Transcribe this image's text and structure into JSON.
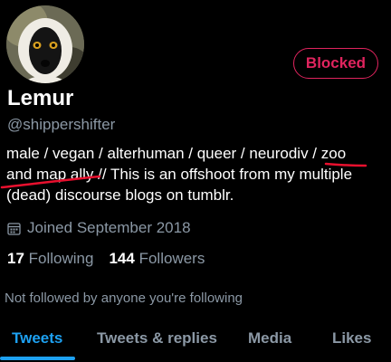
{
  "profile": {
    "display_name": "Lemur",
    "handle": "@shippershifter",
    "avatar": "lemur-avatar",
    "bio_line1": "male / vegan / alterhuman / queer / neurodiv / zoo",
    "bio_line2": "and map ally // This is an offshoot from my multiple",
    "bio_line3": "(dead) discourse blogs on tumblr.",
    "joined": "Joined September 2018",
    "following_count": "17",
    "following_label": "Following",
    "followers_count": "144",
    "followers_label": "Followers",
    "followed_note": "Not followed by anyone you're following"
  },
  "actions": {
    "blocked_label": "Blocked"
  },
  "tabs": [
    {
      "label": "Tweets",
      "active": true
    },
    {
      "label": "Tweets & replies",
      "active": false
    },
    {
      "label": "Media",
      "active": false
    },
    {
      "label": "Likes",
      "active": false
    }
  ],
  "colors": {
    "background": "#000000",
    "accent": "#1da1f2",
    "blocked": "#e0245e",
    "secondary_text": "#8b98a5",
    "annotation": "#e8102e"
  },
  "icons": {
    "joined": "calendar-icon"
  }
}
